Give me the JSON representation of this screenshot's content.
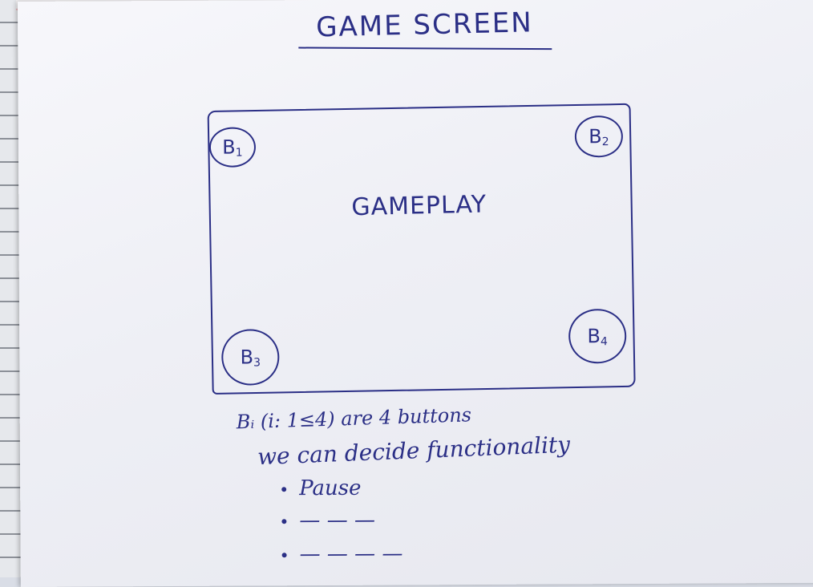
{
  "sheet": {
    "title": "GAME SCREEN"
  },
  "diagram": {
    "gameplay_label": "GAMEPLAY",
    "buttons": [
      {
        "label": "B",
        "sub": "1"
      },
      {
        "label": "B",
        "sub": "2"
      },
      {
        "label": "B",
        "sub": "3"
      },
      {
        "label": "B",
        "sub": "4"
      }
    ]
  },
  "notes": {
    "line1": "Bᵢ (i: 1≤4) are 4 buttons",
    "line2": "we can decide functionality",
    "bullets": [
      "Pause",
      "— — —",
      "— — — —"
    ]
  },
  "colors": {
    "ink": "#2b2f86",
    "paper": "#f2f3f8"
  }
}
